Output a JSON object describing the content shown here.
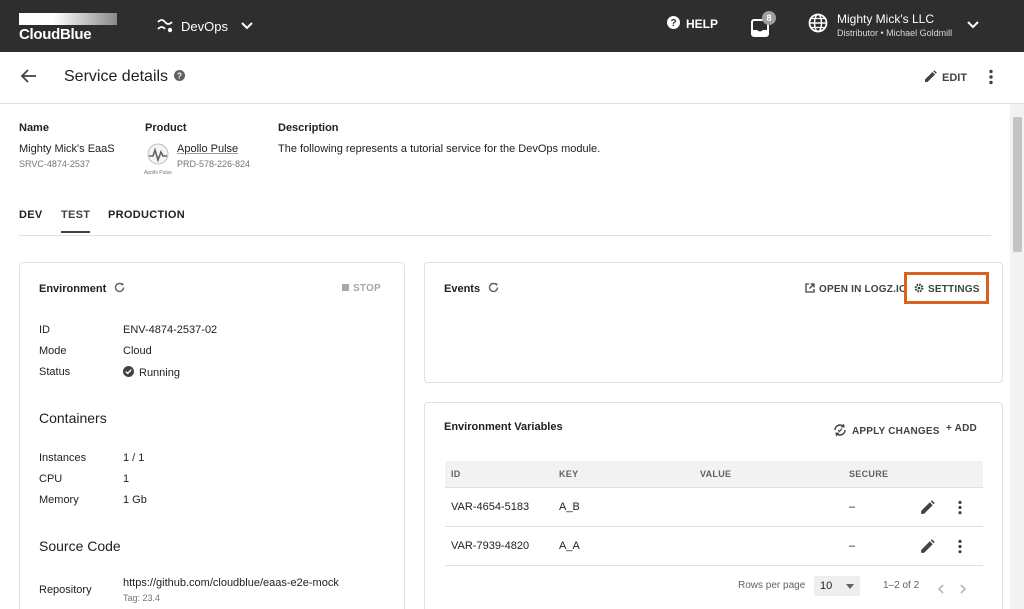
{
  "topbar": {
    "logo_text": "CloudBlue",
    "module_label": "DevOps",
    "help_label": "HELP",
    "notification_count": "8",
    "account_name": "Mighty Mick's LLC",
    "account_sub": "Distributor • Michael Goldmill"
  },
  "header": {
    "title": "Service details",
    "edit_label": "EDIT"
  },
  "info": {
    "name_label": "Name",
    "name_value": "Mighty Mick's EaaS",
    "name_id": "SRVC-4874-2537",
    "product_label": "Product",
    "product_name": "Apollo Pulse",
    "product_id": "PRD-578-226-824",
    "product_icon_caption": "Apollo Pulse",
    "description_label": "Description",
    "description_value": "The following represents a tutorial service for the DevOps module."
  },
  "tabs": [
    {
      "label": "DEV"
    },
    {
      "label": "TEST"
    },
    {
      "label": "PRODUCTION"
    }
  ],
  "environment": {
    "title": "Environment",
    "stop_label": "STOP",
    "fields": [
      {
        "label": "ID",
        "value": "ENV-4874-2537-02"
      },
      {
        "label": "Mode",
        "value": "Cloud"
      },
      {
        "label": "Status",
        "value": "Running"
      }
    ],
    "containers_title": "Containers",
    "containers": [
      {
        "label": "Instances",
        "value": "1 / 1"
      },
      {
        "label": "CPU",
        "value": "1"
      },
      {
        "label": "Memory",
        "value": "1 Gb"
      }
    ],
    "source_title": "Source Code",
    "repository_label": "Repository",
    "repository_url": "https://github.com/cloudblue/eaas-e2e-mock",
    "repository_tag": "Tag: 23.4"
  },
  "events": {
    "title": "Events",
    "open_logz_label": "OPEN IN LOGZ.IO",
    "settings_label": "SETTINGS"
  },
  "env_vars": {
    "title": "Environment Variables",
    "apply_label": "APPLY CHANGES",
    "add_label": "+ ADD",
    "columns": [
      "ID",
      "KEY",
      "VALUE",
      "SECURE"
    ],
    "rows": [
      {
        "id": "VAR-4654-5183",
        "key": "A_B",
        "value": "",
        "secure": "–"
      },
      {
        "id": "VAR-7939-4820",
        "key": "A_A",
        "value": "",
        "secure": "–"
      }
    ],
    "rows_per_page_label": "Rows per page",
    "rows_per_page_value": "10",
    "range_label": "1–2 of 2"
  },
  "colors": {
    "topbar_bg": "#2e2e2e",
    "settings_highlight": "#d9631e"
  }
}
